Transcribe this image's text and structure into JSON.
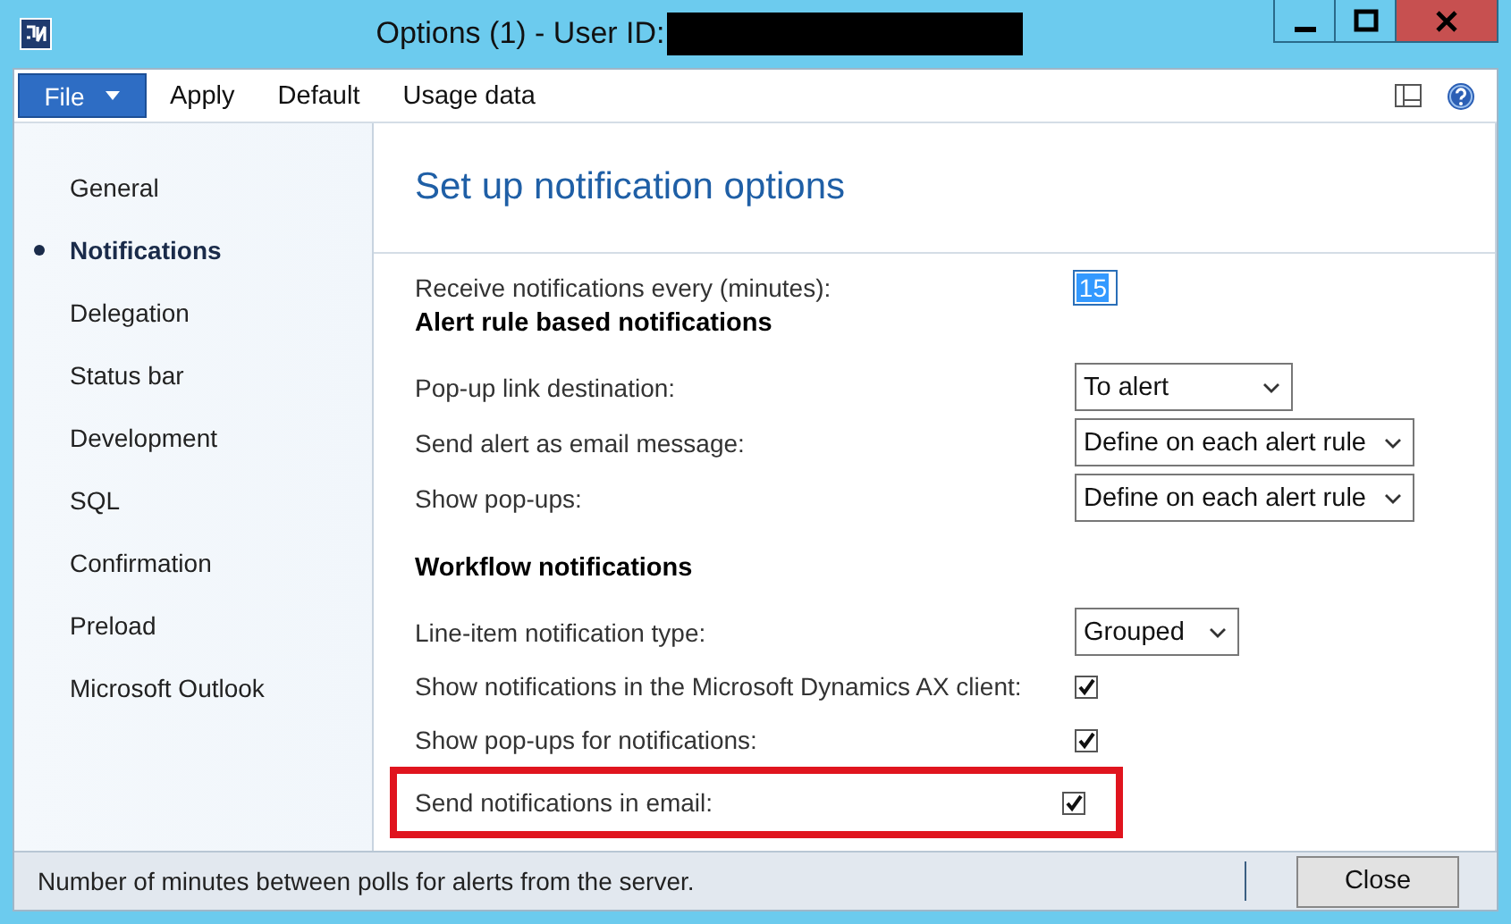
{
  "window": {
    "title": "Options (1) - User ID:"
  },
  "menu": [
    {
      "label": "File",
      "kind": "file"
    },
    {
      "label": "Apply",
      "kind": "plain"
    },
    {
      "label": "Default",
      "kind": "plain"
    },
    {
      "label": "Usage data",
      "kind": "plain"
    }
  ],
  "sidebar": {
    "items": [
      {
        "label": "General",
        "selected": false
      },
      {
        "label": "Notifications",
        "selected": true
      },
      {
        "label": "Delegation",
        "selected": false
      },
      {
        "label": "Status bar",
        "selected": false
      },
      {
        "label": "Development",
        "selected": false
      },
      {
        "label": "SQL",
        "selected": false
      },
      {
        "label": "Confirmation",
        "selected": false
      },
      {
        "label": "Preload",
        "selected": false
      },
      {
        "label": "Microsoft Outlook",
        "selected": false
      }
    ]
  },
  "page": {
    "title": "Set up notification options",
    "groups": [
      {
        "rows": [
          {
            "kind": "number",
            "label": "Receive notifications every (minutes):",
            "value": "15",
            "highlighted": false
          }
        ]
      },
      {
        "heading": "Alert rule based notifications",
        "rows": [
          {
            "kind": "dropdown",
            "label": "Pop-up link destination:",
            "value": "To alert",
            "highlighted": false
          },
          {
            "kind": "dropdown",
            "label": "Send alert as email message:",
            "value": "Define on each alert rule",
            "highlighted": false
          },
          {
            "kind": "dropdown",
            "label": "Show pop-ups:",
            "value": "Define on each alert rule",
            "highlighted": false
          }
        ]
      },
      {
        "heading": "Workflow notifications",
        "rows": [
          {
            "kind": "dropdown",
            "label": "Line-item notification type:",
            "value": "Grouped",
            "highlighted": false
          },
          {
            "kind": "checkbox",
            "label": "Show notifications in the Microsoft Dynamics AX client:",
            "checked": true,
            "highlighted": false
          },
          {
            "kind": "checkbox",
            "label": "Show pop-ups for notifications:",
            "checked": true,
            "highlighted": false
          },
          {
            "kind": "checkbox",
            "label": "Send notifications in email:",
            "checked": true,
            "highlighted": true
          }
        ]
      }
    ]
  },
  "status_bar": {
    "text": "Number of minutes between polls for alerts from the server.",
    "button": "Close"
  }
}
